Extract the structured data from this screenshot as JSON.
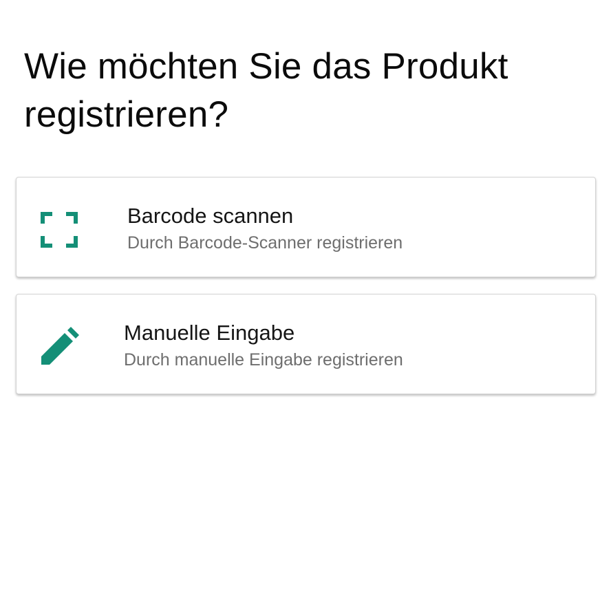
{
  "title": "Wie möchten Sie das Produkt registrieren?",
  "accent_color": "#148f77",
  "options": [
    {
      "icon": "barcode-scan-icon",
      "label": "Barcode scannen",
      "description": "Durch Barcode-Scanner registrieren"
    },
    {
      "icon": "pencil-icon",
      "label": "Manuelle Eingabe",
      "description": "Durch manuelle Eingabe registrieren"
    }
  ]
}
